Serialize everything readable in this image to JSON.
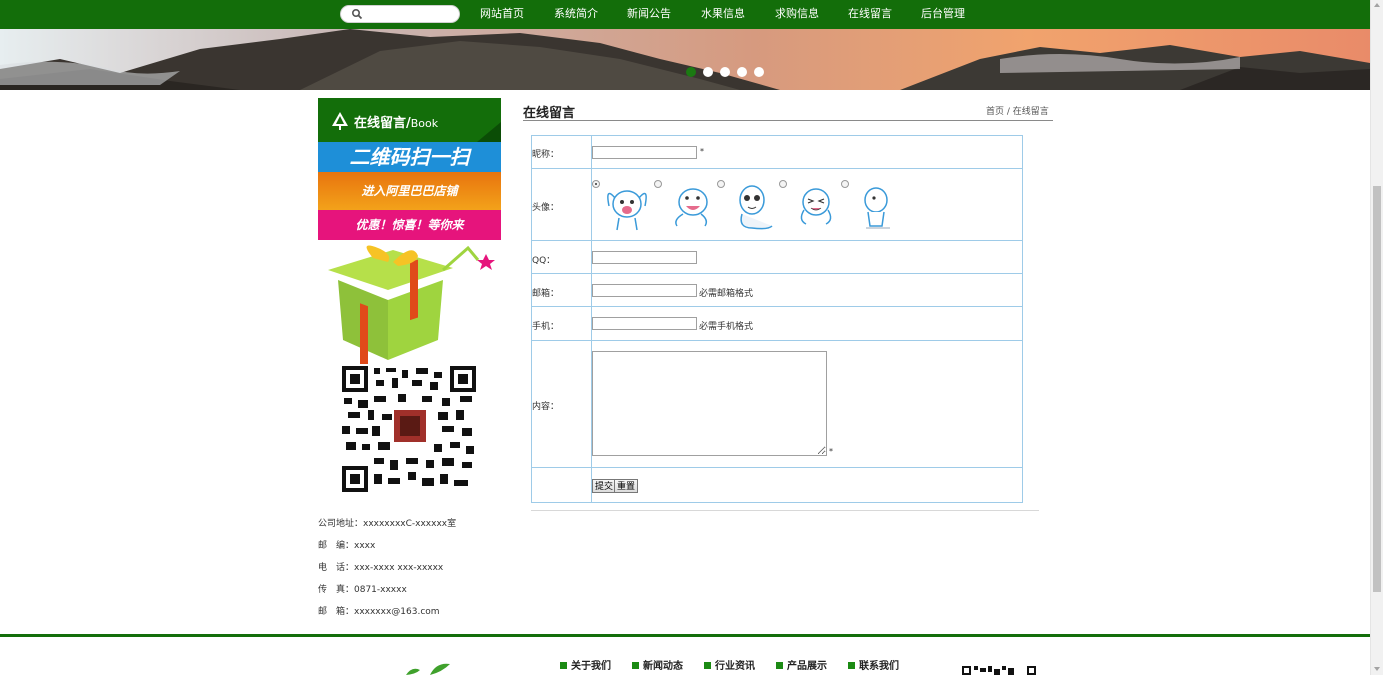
{
  "search": {
    "placeholder": ""
  },
  "nav": {
    "items": [
      "网站首页",
      "系统简介",
      "新闻公告",
      "水果信息",
      "求购信息",
      "在线留言",
      "后台管理"
    ]
  },
  "carousel": {
    "slide_count": 5,
    "active_index": 0
  },
  "sidebar": {
    "title": "在线留言/",
    "title_en": "Book",
    "promo": {
      "line1": "二维码扫一扫",
      "line2": "进入阿里巴巴店铺",
      "line3": "优惠！惊喜！等你来"
    },
    "contact": [
      "公司地址：xxxxxxxxC-xxxxxx室",
      "邮　编：xxxx",
      "电　话：xxx-xxxx xxx-xxxxx",
      "传　真：0871-xxxxx",
      "邮　箱：xxxxxxx@163.com"
    ]
  },
  "page": {
    "title": "在线留言",
    "breadcrumb": "首页  / 在线留言"
  },
  "form": {
    "nickname_label": "昵称：",
    "avatar_label": "头像：",
    "qq_label": "QQ：",
    "email_label": "邮箱：",
    "email_hint": "必需邮箱格式",
    "phone_label": "手机：",
    "phone_hint": "必需手机格式",
    "content_label": "内容：",
    "required_mark": "*",
    "avatar_selected": 0,
    "nickname_value": "",
    "qq_value": "",
    "email_value": "",
    "phone_value": "",
    "content_value": "",
    "submit_label": "提交",
    "reset_label": "重置"
  },
  "footer": {
    "links": [
      "关于我们",
      "新闻动态",
      "行业资讯",
      "产品展示",
      "联系我们"
    ]
  },
  "colors": {
    "brand_green": "#136e0a",
    "table_border": "#9ecbe8"
  }
}
